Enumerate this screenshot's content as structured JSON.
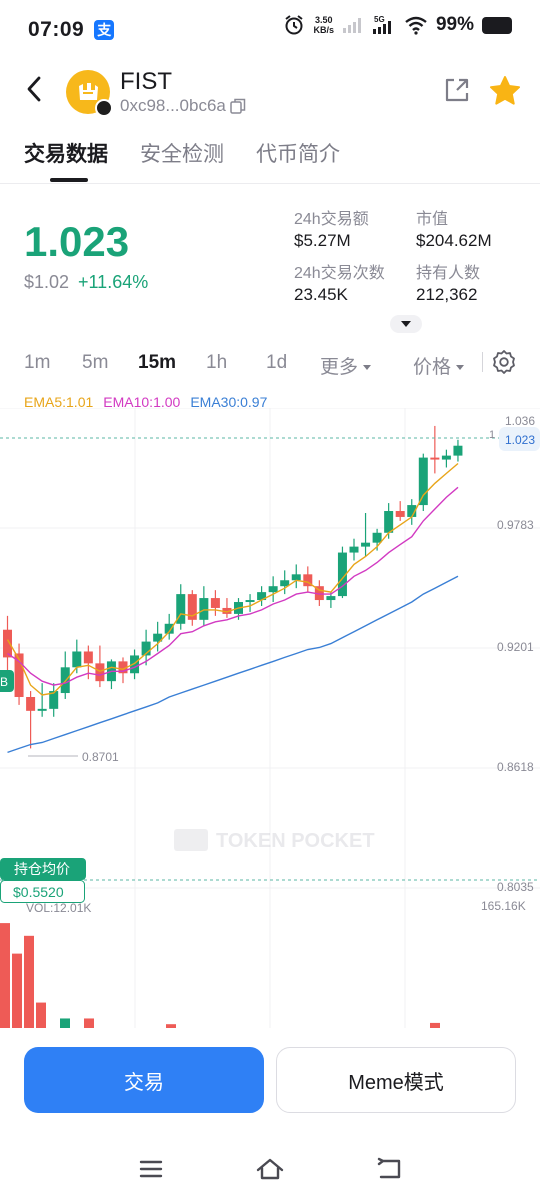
{
  "status": {
    "time": "07:09",
    "net_speed_value": "3.50",
    "net_speed_unit": "KB/s",
    "battery": "99%"
  },
  "token": {
    "name": "FIST",
    "address": "0xc98...0bc6a"
  },
  "tabs": [
    {
      "label": "交易数据",
      "active": true
    },
    {
      "label": "安全检测",
      "active": false
    },
    {
      "label": "代币简介",
      "active": false
    }
  ],
  "price": {
    "main": "1.023",
    "usd": "$1.02",
    "change": "+11.64%"
  },
  "stats": {
    "volume_label": "24h交易额",
    "volume_value": "$5.27M",
    "mcap_label": "市值",
    "mcap_value": "$204.62M",
    "txs_label": "24h交易次数",
    "txs_value": "23.45K",
    "holders_label": "持有人数",
    "holders_value": "212,362"
  },
  "intervals": [
    {
      "label": "1m",
      "active": false
    },
    {
      "label": "5m",
      "active": false
    },
    {
      "label": "15m",
      "active": true
    },
    {
      "label": "1h",
      "active": false
    },
    {
      "label": "1d",
      "active": false
    }
  ],
  "more_label": "更多",
  "price_select_label": "价格",
  "ema": {
    "ema5": "EMA5:1.01",
    "ema10": "EMA10:1.00",
    "ema30": "EMA30:0.97"
  },
  "colors": {
    "up": "#1aa378",
    "down": "#ee5b56",
    "ema5": "#e8a51a",
    "ema10": "#d23ac2",
    "ema30": "#3a7fd5",
    "accent": "#2f80f5"
  },
  "chart_data": {
    "type": "candlestick",
    "y_ticks": [
      "1.036",
      "0.9783",
      "0.9201",
      "0.8618",
      "0.8035"
    ],
    "ylim": [
      0.8035,
      1.036
    ],
    "current_price_label": "1.023",
    "low_marker_label": "0.8701",
    "avg_cost_label": "持仓均价",
    "avg_cost_value": "$0.5520",
    "volume_label": "VOL:12.01K",
    "volume_max_label": "165.16K",
    "watermark": "TOKEN POCKET",
    "left_badge": "B",
    "candles": [
      {
        "o": 0.93,
        "h": 0.937,
        "l": 0.905,
        "c": 0.916
      },
      {
        "o": 0.918,
        "h": 0.923,
        "l": 0.892,
        "c": 0.896
      },
      {
        "o": 0.896,
        "h": 0.899,
        "l": 0.87,
        "c": 0.889
      },
      {
        "o": 0.889,
        "h": 0.903,
        "l": 0.886,
        "c": 0.89
      },
      {
        "o": 0.89,
        "h": 0.903,
        "l": 0.886,
        "c": 0.899
      },
      {
        "o": 0.898,
        "h": 0.919,
        "l": 0.895,
        "c": 0.911
      },
      {
        "o": 0.911,
        "h": 0.925,
        "l": 0.908,
        "c": 0.919
      },
      {
        "o": 0.919,
        "h": 0.922,
        "l": 0.905,
        "c": 0.913
      },
      {
        "o": 0.913,
        "h": 0.922,
        "l": 0.901,
        "c": 0.904
      },
      {
        "o": 0.904,
        "h": 0.915,
        "l": 0.9,
        "c": 0.914
      },
      {
        "o": 0.914,
        "h": 0.916,
        "l": 0.903,
        "c": 0.908
      },
      {
        "o": 0.908,
        "h": 0.92,
        "l": 0.905,
        "c": 0.917
      },
      {
        "o": 0.917,
        "h": 0.93,
        "l": 0.912,
        "c": 0.924
      },
      {
        "o": 0.924,
        "h": 0.934,
        "l": 0.919,
        "c": 0.928
      },
      {
        "o": 0.928,
        "h": 0.938,
        "l": 0.925,
        "c": 0.933
      },
      {
        "o": 0.933,
        "h": 0.953,
        "l": 0.93,
        "c": 0.948
      },
      {
        "o": 0.948,
        "h": 0.95,
        "l": 0.932,
        "c": 0.935
      },
      {
        "o": 0.935,
        "h": 0.952,
        "l": 0.932,
        "c": 0.946
      },
      {
        "o": 0.946,
        "h": 0.95,
        "l": 0.937,
        "c": 0.941
      },
      {
        "o": 0.941,
        "h": 0.946,
        "l": 0.936,
        "c": 0.938
      },
      {
        "o": 0.938,
        "h": 0.946,
        "l": 0.935,
        "c": 0.944
      },
      {
        "o": 0.944,
        "h": 0.948,
        "l": 0.939,
        "c": 0.945
      },
      {
        "o": 0.945,
        "h": 0.952,
        "l": 0.942,
        "c": 0.949
      },
      {
        "o": 0.949,
        "h": 0.957,
        "l": 0.944,
        "c": 0.952
      },
      {
        "o": 0.952,
        "h": 0.96,
        "l": 0.948,
        "c": 0.955
      },
      {
        "o": 0.955,
        "h": 0.963,
        "l": 0.951,
        "c": 0.958
      },
      {
        "o": 0.958,
        "h": 0.962,
        "l": 0.949,
        "c": 0.952
      },
      {
        "o": 0.952,
        "h": 0.955,
        "l": 0.942,
        "c": 0.945
      },
      {
        "o": 0.945,
        "h": 0.949,
        "l": 0.941,
        "c": 0.947
      },
      {
        "o": 0.947,
        "h": 0.972,
        "l": 0.946,
        "c": 0.969
      },
      {
        "o": 0.969,
        "h": 0.976,
        "l": 0.965,
        "c": 0.972
      },
      {
        "o": 0.972,
        "h": 0.989,
        "l": 0.967,
        "c": 0.974
      },
      {
        "o": 0.974,
        "h": 0.981,
        "l": 0.97,
        "c": 0.979
      },
      {
        "o": 0.979,
        "h": 0.994,
        "l": 0.976,
        "c": 0.99
      },
      {
        "o": 0.99,
        "h": 0.995,
        "l": 0.985,
        "c": 0.987
      },
      {
        "o": 0.987,
        "h": 0.996,
        "l": 0.983,
        "c": 0.993
      },
      {
        "o": 0.993,
        "h": 1.019,
        "l": 0.99,
        "c": 1.017
      },
      {
        "o": 1.017,
        "h": 1.033,
        "l": 1.009,
        "c": 1.016
      },
      {
        "o": 1.016,
        "h": 1.021,
        "l": 1.012,
        "c": 1.018
      },
      {
        "o": 1.018,
        "h": 1.026,
        "l": 1.015,
        "c": 1.023
      }
    ],
    "volumes_red": [
      165.0,
      117.0,
      145.0,
      40.0,
      15.0,
      15.0,
      6.0,
      8.0
    ],
    "ema5": [
      0.925,
      0.915,
      0.902,
      0.897,
      0.898,
      0.904,
      0.911,
      0.912,
      0.909,
      0.911,
      0.91,
      0.913,
      0.918,
      0.923,
      0.929,
      0.938,
      0.937,
      0.94,
      0.94,
      0.939,
      0.941,
      0.942,
      0.945,
      0.948,
      0.951,
      0.955,
      0.954,
      0.95,
      0.949,
      0.956,
      0.963,
      0.967,
      0.972,
      0.979,
      0.983,
      0.987,
      0.998,
      1.004,
      1.009,
      1.014
    ],
    "ema10": [
      0.918,
      0.914,
      0.908,
      0.904,
      0.902,
      0.903,
      0.906,
      0.908,
      0.907,
      0.909,
      0.909,
      0.911,
      0.914,
      0.918,
      0.922,
      0.928,
      0.929,
      0.932,
      0.934,
      0.935,
      0.937,
      0.938,
      0.94,
      0.943,
      0.945,
      0.948,
      0.949,
      0.948,
      0.948,
      0.952,
      0.957,
      0.96,
      0.964,
      0.969,
      0.973,
      0.977,
      0.985,
      0.991,
      0.997,
      1.002
    ],
    "ema30": [
      0.868,
      0.87,
      0.872,
      0.873,
      0.875,
      0.877,
      0.879,
      0.881,
      0.883,
      0.885,
      0.887,
      0.889,
      0.891,
      0.893,
      0.896,
      0.898,
      0.9,
      0.902,
      0.904,
      0.906,
      0.908,
      0.91,
      0.912,
      0.914,
      0.916,
      0.918,
      0.92,
      0.921,
      0.923,
      0.926,
      0.929,
      0.932,
      0.935,
      0.938,
      0.941,
      0.944,
      0.948,
      0.951,
      0.954,
      0.957
    ]
  },
  "buttons": {
    "trade": "交易",
    "meme": "Meme模式"
  }
}
